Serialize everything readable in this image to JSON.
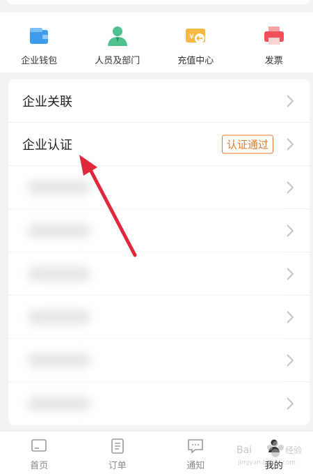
{
  "quick_actions": [
    {
      "label": "企业钱包",
      "icon": "wallet-icon",
      "color": "#3d9be9"
    },
    {
      "label": "人员及部门",
      "icon": "person-icon",
      "color": "#4fc08d"
    },
    {
      "label": "充值中心",
      "icon": "recharge-card-icon",
      "color": "#f5b942"
    },
    {
      "label": "发票",
      "icon": "printer-icon",
      "color": "#f0505a"
    }
  ],
  "list": {
    "rows": [
      {
        "label": "企业关联"
      },
      {
        "label": "企业认证",
        "badge": "认证通过"
      }
    ]
  },
  "tabbar": {
    "items": [
      {
        "label": "首页",
        "icon": "home-icon"
      },
      {
        "label": "订单",
        "icon": "order-icon"
      },
      {
        "label": "通知",
        "icon": "message-icon"
      },
      {
        "label": "我的",
        "icon": "profile-icon"
      }
    ]
  },
  "colors": {
    "accent": "#e07b2b",
    "arrow": "#e0283a"
  }
}
